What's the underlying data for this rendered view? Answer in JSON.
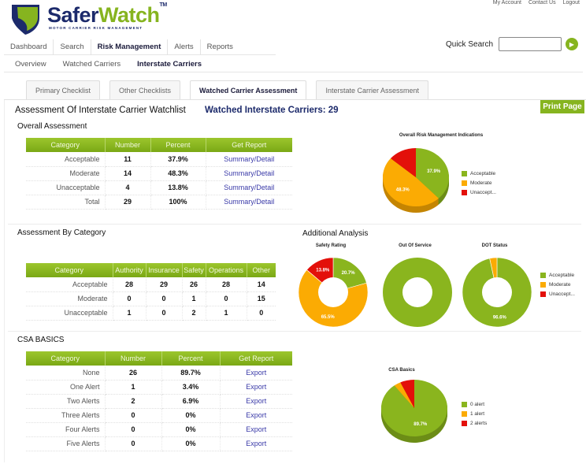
{
  "brand": {
    "name_part1": "Safer",
    "name_part2": "Watch",
    "trademark": "TM",
    "tagline": "MOTOR CARRIER RISK MANAGEMENT",
    "colors": {
      "navy": "#1c2a6b",
      "green": "#86b41f"
    }
  },
  "top_links": [
    "My Account",
    "Contact Us",
    "Logout"
  ],
  "quick_search": {
    "label": "Quick Search",
    "value": "",
    "placeholder": "",
    "go_icon": "arrow-right-icon"
  },
  "main_nav": [
    {
      "label": "Dashboard",
      "active": false
    },
    {
      "label": "Search",
      "active": false
    },
    {
      "label": "Risk Management",
      "active": true
    },
    {
      "label": "Alerts",
      "active": false
    },
    {
      "label": "Reports",
      "active": false
    }
  ],
  "sub_nav": [
    {
      "label": "Overview",
      "active": false
    },
    {
      "label": "Watched Carriers",
      "active": false
    },
    {
      "label": "Interstate Carriers",
      "active": true
    }
  ],
  "tabs": [
    {
      "label": "Primary Checklist",
      "active": false
    },
    {
      "label": "Other Checklists",
      "active": false
    },
    {
      "label": "Watched Carrier Assessment",
      "active": true
    },
    {
      "label": "Interstate Carrier Assessment",
      "active": false
    }
  ],
  "page": {
    "title": "Assessment Of Interstate Carrier Watchlist",
    "watched_label": "Watched Interstate Carriers: 29",
    "print_label": "Print Page"
  },
  "overall": {
    "title": "Overall Assessment",
    "headers": [
      "Category",
      "Number",
      "Percent",
      "Get Report"
    ],
    "rows": [
      [
        "Acceptable",
        "11",
        "37.9%",
        "Summary/Detail"
      ],
      [
        "Moderate",
        "14",
        "48.3%",
        "Summary/Detail"
      ],
      [
        "Unacceptable",
        "4",
        "13.8%",
        "Summary/Detail"
      ],
      [
        "Total",
        "29",
        "100%",
        "Summary/Detail"
      ]
    ]
  },
  "by_category": {
    "title": "Assessment By Category",
    "headers": [
      "Category",
      "Authority",
      "Insurance",
      "Safety",
      "Operations",
      "Other"
    ],
    "rows": [
      [
        "Acceptable",
        "28",
        "29",
        "26",
        "28",
        "14"
      ],
      [
        "Moderate",
        "0",
        "0",
        "1",
        "0",
        "15"
      ],
      [
        "Unacceptable",
        "1",
        "0",
        "2",
        "1",
        "0"
      ]
    ]
  },
  "additional": {
    "title": "Additional Analysis"
  },
  "csa": {
    "title": "CSA BASICS",
    "headers": [
      "Category",
      "Number",
      "Percent",
      "Get Report"
    ],
    "rows": [
      [
        "None",
        "26",
        "89.7%",
        "Export"
      ],
      [
        "One Alert",
        "1",
        "3.4%",
        "Export"
      ],
      [
        "Two Alerts",
        "2",
        "6.9%",
        "Export"
      ],
      [
        "Three Alerts",
        "0",
        "0%",
        "Export"
      ],
      [
        "Four Alerts",
        "0",
        "0%",
        "Export"
      ],
      [
        "Five Alerts",
        "0",
        "0%",
        "Export"
      ]
    ]
  },
  "chart_data": [
    {
      "id": "overall-pie",
      "type": "pie",
      "title": "Overall Risk Management Indications",
      "categories": [
        "Acceptable",
        "Moderate",
        "Unaccept..."
      ],
      "values": [
        37.9,
        48.3,
        13.8
      ],
      "labels": [
        "37.9%",
        "48.3%",
        ""
      ],
      "colors": [
        "#8ab51e",
        "#fbab03",
        "#e3100a"
      ],
      "legend": "right"
    },
    {
      "id": "safety-donut",
      "type": "pie",
      "title": "Safety Rating",
      "categories": [
        "Acceptable",
        "Moderate",
        "Unaccept..."
      ],
      "values": [
        20.7,
        65.5,
        13.8
      ],
      "labels": [
        "20.7%",
        "65.5%",
        "13.8%"
      ],
      "colors": [
        "#8ab51e",
        "#fbab03",
        "#e3100a"
      ]
    },
    {
      "id": "oos-donut",
      "type": "pie",
      "title": "Out Of Service",
      "categories": [
        "Acceptable",
        "Moderate",
        "Unaccept..."
      ],
      "values": [
        100,
        0,
        0
      ],
      "labels": [
        "",
        "",
        ""
      ],
      "colors": [
        "#8ab51e",
        "#fbab03",
        "#e3100a"
      ]
    },
    {
      "id": "dot-donut",
      "type": "pie",
      "title": "DOT Status",
      "categories": [
        "Acceptable",
        "Moderate",
        "Unaccept..."
      ],
      "values": [
        96.6,
        3.4,
        0
      ],
      "labels": [
        "96.6%",
        "",
        ""
      ],
      "colors": [
        "#8ab51e",
        "#fbab03",
        "#e3100a"
      ],
      "legend": "right"
    },
    {
      "id": "csa-pie",
      "type": "pie",
      "title": "CSA Basics",
      "categories": [
        "0 alert",
        "1 alert",
        "2 alerts"
      ],
      "values": [
        89.7,
        3.4,
        6.9
      ],
      "labels": [
        "89.7%",
        "",
        ""
      ],
      "colors": [
        "#8ab51e",
        "#fbab03",
        "#e3100a"
      ],
      "legend": "right"
    }
  ]
}
